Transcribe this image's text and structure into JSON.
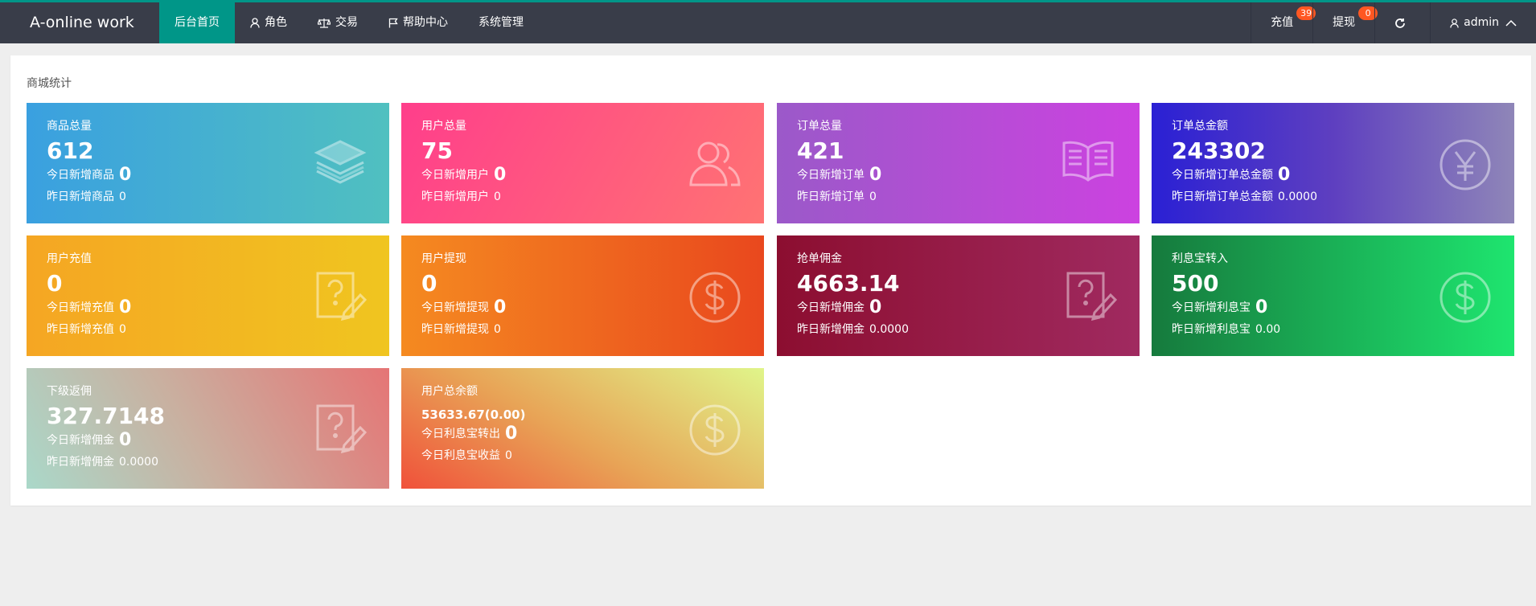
{
  "header": {
    "logo": "A-online work",
    "nav": [
      {
        "label": "后台首页",
        "icon": "none"
      },
      {
        "label": "角色",
        "icon": "user-icon"
      },
      {
        "label": "交易",
        "icon": "scale-icon"
      },
      {
        "label": "帮助中心",
        "icon": "flag-icon"
      },
      {
        "label": "系统管理",
        "icon": "none"
      }
    ],
    "recharge": {
      "label": "充值",
      "badge": "39"
    },
    "withdraw": {
      "label": "提现",
      "badge": "0"
    },
    "refresh_icon": "refresh-icon",
    "user": {
      "label": "admin",
      "icon": "user-icon",
      "chevron": "chevron-up-icon"
    }
  },
  "panel": {
    "title": "商城统计"
  },
  "cards": [
    {
      "label": "商品总量",
      "total": "612",
      "today_label": "今日新增商品",
      "today_value": "0",
      "yest_label": "昨日新增商品",
      "yest_value": "0",
      "icon": "layers-icon"
    },
    {
      "label": "用户总量",
      "total": "75",
      "today_label": "今日新增用户",
      "today_value": "0",
      "yest_label": "昨日新增用户",
      "yest_value": "0",
      "icon": "users-icon"
    },
    {
      "label": "订单总量",
      "total": "421",
      "today_label": "今日新增订单",
      "today_value": "0",
      "yest_label": "昨日新增订单",
      "yest_value": "0",
      "icon": "book-icon"
    },
    {
      "label": "订单总金额",
      "total": "243302",
      "today_label": "今日新增订单总金额",
      "today_value": "0",
      "yest_label": "昨日新增订单总金额",
      "yest_value": "0.0000",
      "icon": "yen-icon"
    },
    {
      "label": "用户充值",
      "total": "0",
      "today_label": "今日新增充值",
      "today_value": "0",
      "yest_label": "昨日新增充值",
      "yest_value": "0",
      "icon": "question-edit-icon"
    },
    {
      "label": "用户提现",
      "total": "0",
      "today_label": "今日新增提现",
      "today_value": "0",
      "yest_label": "昨日新增提现",
      "yest_value": "0",
      "icon": "dollar-icon"
    },
    {
      "label": "抢单佣金",
      "total": "4663.14",
      "today_label": "今日新增佣金",
      "today_value": "0",
      "yest_label": "昨日新增佣金",
      "yest_value": "0.0000",
      "icon": "question-edit-icon"
    },
    {
      "label": "利息宝转入",
      "total": "500",
      "today_label": "今日新增利息宝",
      "today_value": "0",
      "yest_label": "昨日新增利息宝",
      "yest_value": "0.00",
      "icon": "dollar-icon"
    },
    {
      "label": "下级返佣",
      "total": "327.7148",
      "today_label": "今日新增佣金",
      "today_value": "0",
      "yest_label": "昨日新增佣金",
      "yest_value": "0.0000",
      "icon": "question-edit-icon"
    },
    {
      "label": "用户总余额",
      "total": "53633.67(0.00)",
      "today_label": "今日利息宝转出",
      "today_value": "0",
      "yest_label": "今日利息宝收益",
      "yest_value": "0",
      "icon": "dollar-icon"
    }
  ],
  "colors": {
    "topbar": "#393d49",
    "accent": "#009688",
    "badge": "#ff5722"
  }
}
